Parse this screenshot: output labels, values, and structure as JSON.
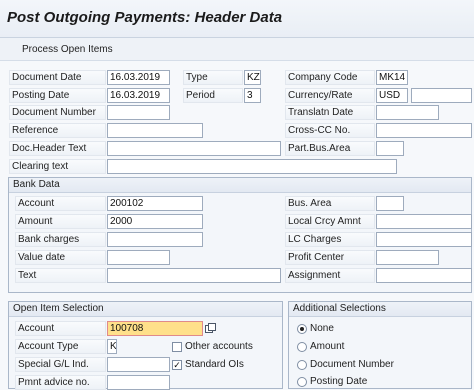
{
  "window": {
    "title": "Post Outgoing Payments: Header Data"
  },
  "toolbar": {
    "process_open_items": "Process Open Items"
  },
  "header": {
    "document_date": {
      "label": "Document Date",
      "value": "16.03.2019"
    },
    "type": {
      "label": "Type",
      "value": "KZ"
    },
    "company_code": {
      "label": "Company Code",
      "value": "MK14"
    },
    "posting_date": {
      "label": "Posting Date",
      "value": "16.03.2019"
    },
    "period": {
      "label": "Period",
      "value": "3"
    },
    "currency_rate": {
      "label": "Currency/Rate",
      "value": "USD",
      "rate": ""
    },
    "document_number": {
      "label": "Document Number",
      "value": ""
    },
    "translatn_date": {
      "label": "Translatn Date",
      "value": ""
    },
    "reference": {
      "label": "Reference",
      "value": ""
    },
    "cross_cc_no": {
      "label": "Cross-CC No.",
      "value": ""
    },
    "doc_header_text": {
      "label": "Doc.Header Text",
      "value": ""
    },
    "part_bus_area": {
      "label": "Part.Bus.Area",
      "value": ""
    },
    "clearing_text": {
      "label": "Clearing text",
      "value": ""
    }
  },
  "bank_data": {
    "title": "Bank Data",
    "account": {
      "label": "Account",
      "value": "200102"
    },
    "bus_area": {
      "label": "Bus. Area",
      "value": ""
    },
    "amount": {
      "label": "Amount",
      "value": "2000"
    },
    "local_crcy_amnt": {
      "label": "Local Crcy Amnt",
      "value": ""
    },
    "bank_charges": {
      "label": "Bank charges",
      "value": ""
    },
    "lc_charges": {
      "label": "LC Charges",
      "value": ""
    },
    "value_date": {
      "label": "Value date",
      "value": ""
    },
    "profit_center": {
      "label": "Profit Center",
      "value": ""
    },
    "text": {
      "label": "Text",
      "value": ""
    },
    "assignment": {
      "label": "Assignment",
      "value": ""
    }
  },
  "open_item_selection": {
    "title": "Open Item Selection",
    "account": {
      "label": "Account",
      "value": "100708"
    },
    "account_type": {
      "label": "Account Type",
      "value": "K"
    },
    "other_accounts": {
      "label": "Other accounts",
      "checked": false
    },
    "special_gl": {
      "label": "Special G/L Ind.",
      "value": ""
    },
    "standard_ois": {
      "label": "Standard OIs",
      "checked": true
    },
    "pmnt_advice": {
      "label": "Pmnt advice no.",
      "value": ""
    }
  },
  "additional_selections": {
    "title": "Additional Selections",
    "options": [
      {
        "label": "None",
        "selected": true
      },
      {
        "label": "Amount",
        "selected": false
      },
      {
        "label": "Document Number",
        "selected": false
      },
      {
        "label": "Posting Date",
        "selected": false
      }
    ]
  },
  "colors": {
    "focus_field": "#ffe08a",
    "group_border": "#aab7c9",
    "background": "#f6f8fb"
  }
}
